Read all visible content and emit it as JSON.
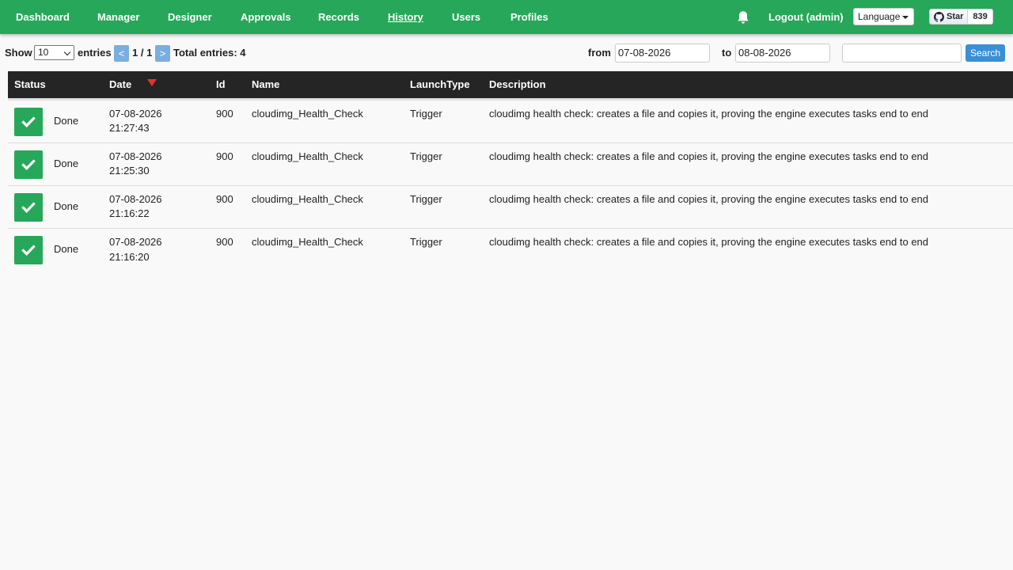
{
  "colors": {
    "nav": "#27a75a",
    "header": "#252525",
    "done": "#27a75a",
    "button": "#3a8fd6",
    "sort": "#e8322b"
  },
  "nav": {
    "items": [
      {
        "label": "Dashboard"
      },
      {
        "label": "Manager"
      },
      {
        "label": "Designer"
      },
      {
        "label": "Approvals"
      },
      {
        "label": "Records"
      },
      {
        "label": "History"
      },
      {
        "label": "Users"
      },
      {
        "label": "Profiles"
      }
    ],
    "active": "History",
    "notification_icon": "bell-icon",
    "logout_label": "Logout (admin)",
    "language_label": "Language",
    "github": {
      "star_label": "Star",
      "count": "839",
      "icon": "github-icon"
    }
  },
  "toolbar": {
    "show_label": "Show",
    "entries_selected": "10",
    "entries_label": "entries",
    "prev_label": "<",
    "page_label": "1 / 1",
    "next_label": ">",
    "total_label": "Total entries: 4",
    "from_label": "from",
    "from_value": "07-08-2026",
    "to_label": "to",
    "to_value": "08-08-2026",
    "search_value": "",
    "search_button": "Search"
  },
  "table": {
    "columns": [
      "Status",
      "Date",
      "Id",
      "Name",
      "LaunchType",
      "Description"
    ],
    "sort_icon": "sort-desc-icon",
    "rows": [
      {
        "status": "Done",
        "date": "07-08-2026",
        "time": "21:27:43",
        "id": "900",
        "name": "cloudimg_Health_Check",
        "launch_type": "Trigger",
        "description": "cloudimg health check: creates a file and copies it, proving the engine executes tasks end to end"
      },
      {
        "status": "Done",
        "date": "07-08-2026",
        "time": "21:25:30",
        "id": "900",
        "name": "cloudimg_Health_Check",
        "launch_type": "Trigger",
        "description": "cloudimg health check: creates a file and copies it, proving the engine executes tasks end to end"
      },
      {
        "status": "Done",
        "date": "07-08-2026",
        "time": "21:16:22",
        "id": "900",
        "name": "cloudimg_Health_Check",
        "launch_type": "Trigger",
        "description": "cloudimg health check: creates a file and copies it, proving the engine executes tasks end to end"
      },
      {
        "status": "Done",
        "date": "07-08-2026",
        "time": "21:16:20",
        "id": "900",
        "name": "cloudimg_Health_Check",
        "launch_type": "Trigger",
        "description": "cloudimg health check: creates a file and copies it, proving the engine executes tasks end to end"
      }
    ]
  }
}
